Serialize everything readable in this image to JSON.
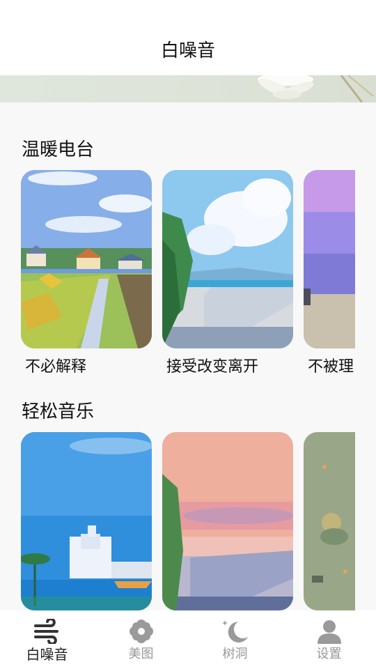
{
  "header": {
    "title": "白噪音"
  },
  "sections": [
    {
      "title": "温暖电台",
      "cards": [
        {
          "label": "不必解释"
        },
        {
          "label": "接受改变离开"
        },
        {
          "label": "不被理"
        }
      ]
    },
    {
      "title": "轻松音乐",
      "cards": [
        {
          "label": ""
        },
        {
          "label": ""
        },
        {
          "label": ""
        }
      ]
    }
  ],
  "tabbar": {
    "active": 0,
    "tabs": [
      {
        "label": "白噪音",
        "icon": "wind-icon"
      },
      {
        "label": "美图",
        "icon": "flower-icon"
      },
      {
        "label": "树洞",
        "icon": "moon-stars-icon"
      },
      {
        "label": "设置",
        "icon": "user-icon"
      }
    ]
  },
  "colors": {
    "active": "#222222",
    "inactive": "#999999",
    "background": "#f8f8f8"
  }
}
